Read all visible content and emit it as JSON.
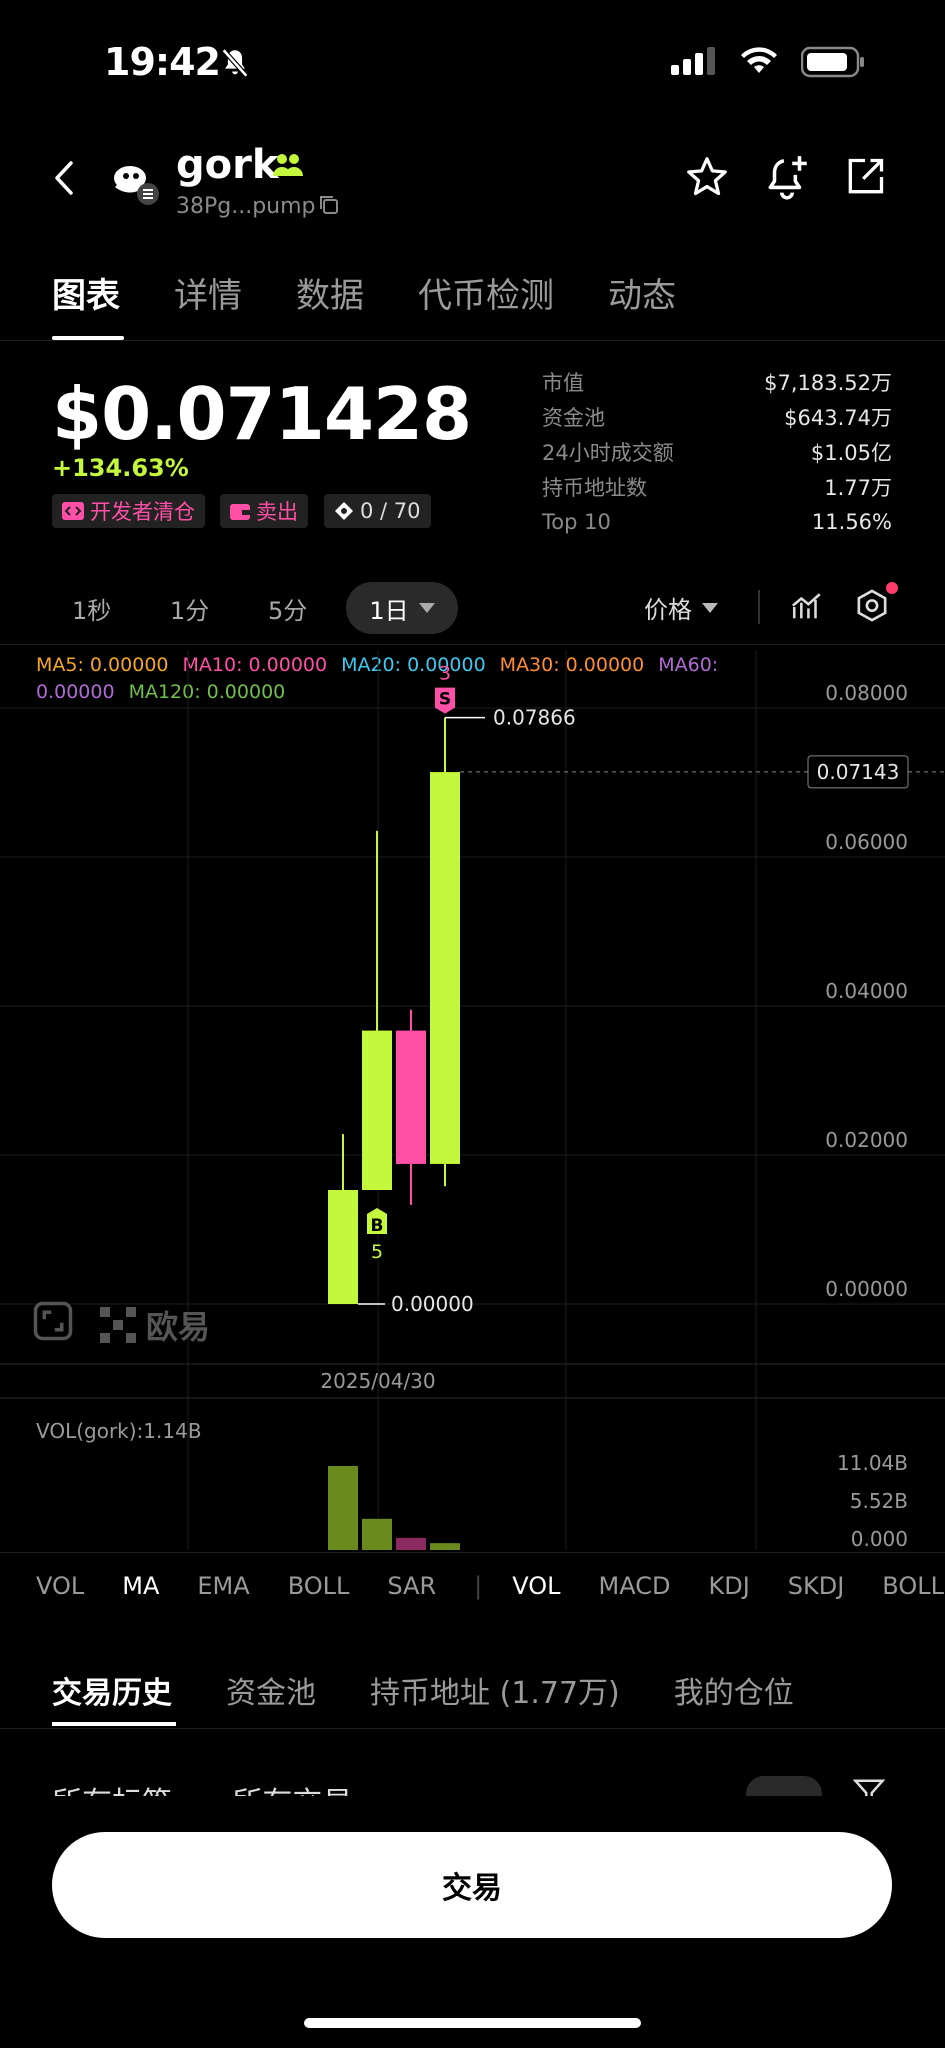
{
  "status": {
    "time": "19:42"
  },
  "header": {
    "token_name": "gork",
    "token_address": "38Pg...pump",
    "icons": [
      "back-icon",
      "community-icon",
      "copy-icon",
      "star-icon",
      "bell-plus-icon",
      "share-icon"
    ]
  },
  "tabs": [
    {
      "label": "图表",
      "active": true
    },
    {
      "label": "详情"
    },
    {
      "label": "数据"
    },
    {
      "label": "代币检测"
    },
    {
      "label": "动态"
    }
  ],
  "price": {
    "value": "$0.071428",
    "change": "+134.63%",
    "tags": {
      "dev": "开发者清仓",
      "sell": "卖出",
      "score": "0 / 70"
    }
  },
  "stats": [
    {
      "label": "市值",
      "value": "$7,183.52万"
    },
    {
      "label": "资金池",
      "value": "$643.74万"
    },
    {
      "label": "24小时成交额",
      "value": "$1.05亿"
    },
    {
      "label": "持币地址数",
      "value": "1.77万"
    },
    {
      "label": "Top 10",
      "value": "11.56%"
    }
  ],
  "intervals": [
    "1秒",
    "1分",
    "5分",
    "1日"
  ],
  "price_dropdown": "价格",
  "ma_legend": {
    "ma5": "MA5: 0.00000",
    "ma10": "MA10: 0.00000",
    "ma20": "MA20: 0.00000",
    "ma30": "MA30: 0.00000",
    "ma60_a": "MA60:",
    "ma60_b": "0.00000",
    "ma120": "MA120: 0.00000"
  },
  "chart_data": {
    "type": "candlestick",
    "y_ticks": [
      "0.08000",
      "0.06000",
      "0.04000",
      "0.02000",
      "0.00000"
    ],
    "ylim": [
      0,
      0.08
    ],
    "x_label": "2025/04/30",
    "current_price_label": "0.07143",
    "current_price": 0.07143,
    "high_label": "0.07866",
    "low_label": "0.00000",
    "candles": [
      {
        "open": 0.0,
        "close": 0.0153,
        "high": 0.0228,
        "low": 0.0,
        "up": true
      },
      {
        "open": 0.0153,
        "close": 0.0367,
        "high": 0.0635,
        "low": 0.0153,
        "up": true
      },
      {
        "open": 0.0367,
        "close": 0.0188,
        "high": 0.0395,
        "low": 0.0133,
        "up": false
      },
      {
        "open": 0.0188,
        "close": 0.0714,
        "high": 0.0787,
        "low": 0.0158,
        "up": true
      }
    ],
    "markers": [
      {
        "type": "B",
        "count": "5",
        "candle": 1
      },
      {
        "type": "S",
        "count": "3",
        "candle": 3
      }
    ],
    "volume": {
      "label": "VOL(gork):1.14B",
      "ticks": [
        "11.04B",
        "5.52B",
        "0.000"
      ],
      "values": [
        11.04,
        4.1,
        1.6,
        0.9
      ]
    },
    "watermark": "欧易"
  },
  "indicators": [
    "VOL",
    "MA",
    "EMA",
    "BOLL",
    "SAR",
    "VOL",
    "MACD",
    "KDJ",
    "SKDJ",
    "BOLL"
  ],
  "bottom_tabs": [
    "交易历史",
    "资金池",
    "持币地址 (1.77万)",
    "我的仓位"
  ],
  "filters": [
    "所有标签 -",
    "所有交易 -"
  ],
  "trade_button": "交易",
  "colors": {
    "up": "#c4f83c",
    "down": "#ff4fa6",
    "accent": "#c4f83c"
  }
}
